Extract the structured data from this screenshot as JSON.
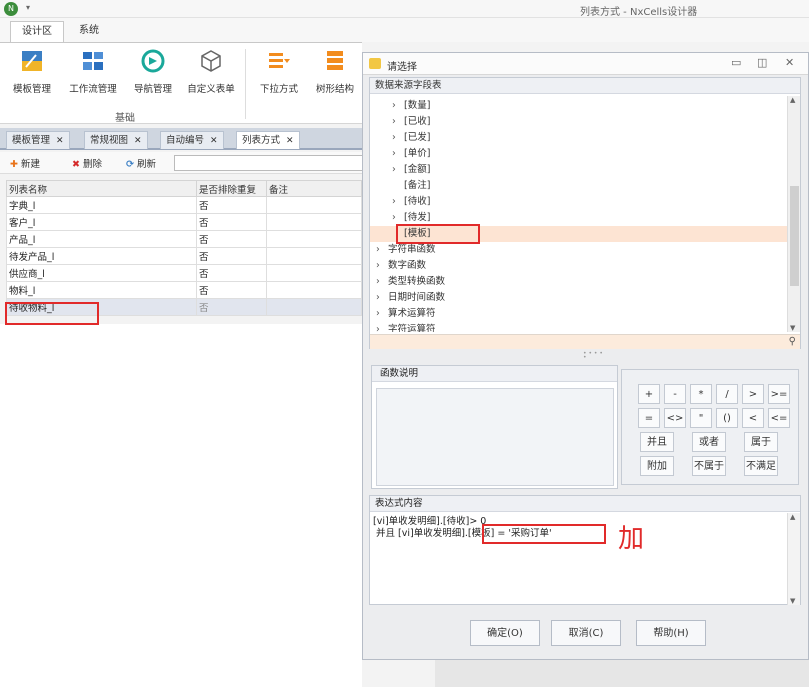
{
  "window": {
    "title": "列表方式 - NxCells设计器"
  },
  "ribbon_tabs": [
    "设计区",
    "系统"
  ],
  "ribbon": {
    "buttons": [
      {
        "label": "模板管理",
        "icon": "template-icon"
      },
      {
        "label": "工作流管理",
        "icon": "workflow-icon"
      },
      {
        "label": "导航管理",
        "icon": "navigation-icon"
      },
      {
        "label": "自定义表单",
        "icon": "cube-icon"
      },
      {
        "label": "下拉方式",
        "icon": "dropdown-list-icon"
      },
      {
        "label": "树形结构",
        "icon": "tree-structure-icon"
      }
    ],
    "group_label": "基础"
  },
  "doc_tabs": [
    "模板管理",
    "常规视图",
    "自动编号",
    "列表方式"
  ],
  "toolbar": {
    "new_label": "新建",
    "delete_label": "删除",
    "refresh_label": "刷新"
  },
  "grid": {
    "headers": [
      "列表名称",
      "是否排除重复",
      "备注"
    ],
    "rows": [
      [
        "字典_l",
        "否",
        ""
      ],
      [
        "客户_l",
        "否",
        ""
      ],
      [
        "产品_l",
        "否",
        ""
      ],
      [
        "待发产品_l",
        "否",
        ""
      ],
      [
        "供应商_l",
        "否",
        ""
      ],
      [
        "物料_l",
        "否",
        ""
      ],
      [
        "待收物料_l",
        "否",
        ""
      ]
    ]
  },
  "dialog": {
    "title": "请选择",
    "datasource_header": "数据来源字段表",
    "tree": [
      {
        "label": "[数量]",
        "expand": true
      },
      {
        "label": "[已收]",
        "expand": true
      },
      {
        "label": "[已发]",
        "expand": true
      },
      {
        "label": "[单价]",
        "expand": true
      },
      {
        "label": "[金额]",
        "expand": true
      },
      {
        "label": "[备注]",
        "expand": false
      },
      {
        "label": "[待收]",
        "expand": true
      },
      {
        "label": "[待发]",
        "expand": true
      },
      {
        "label": "[模板]",
        "expand": false
      },
      {
        "label": "字符串函数",
        "expand": true
      },
      {
        "label": "数字函数",
        "expand": true
      },
      {
        "label": "类型转换函数",
        "expand": true
      },
      {
        "label": "日期时间函数",
        "expand": true
      },
      {
        "label": "算术运算符",
        "expand": true
      },
      {
        "label": "字符运算符",
        "expand": true
      }
    ],
    "function_help_header": "函数说明",
    "operators_row1": [
      "+",
      "-",
      "*",
      "/",
      ">",
      ">="
    ],
    "operators_row2": [
      "=",
      "<>",
      "\"",
      "()",
      "<",
      "<="
    ],
    "operators_row3": [
      "并且",
      "或者",
      "属于"
    ],
    "operators_row4": [
      "附加",
      "不属于",
      "不满足"
    ],
    "expression_header": "表达式内容",
    "expression_line1": "[vi]单收发明细].[待收]> 0",
    "expression_line2": "并且 [vi]单收发明细].[模板] = '采购订单'",
    "annotation": "加",
    "ok_label": "确定(O)",
    "cancel_label": "取消(C)",
    "help_label": "帮助(H)"
  }
}
